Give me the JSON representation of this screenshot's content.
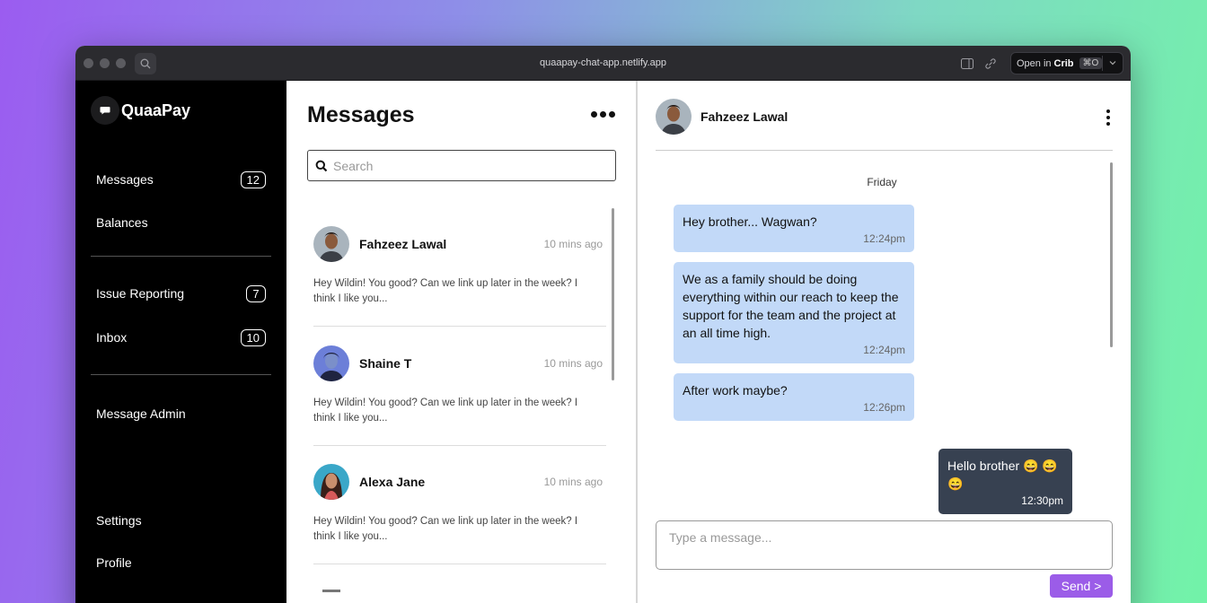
{
  "browser": {
    "url": "quaapay-chat-app.netlify.app",
    "open_in_prefix": "Open in",
    "open_in_app": "Crib",
    "open_shortcut": "⌘O"
  },
  "sidebar": {
    "brand": "QuaaPay",
    "items": [
      {
        "label": "Messages",
        "badge": "12"
      },
      {
        "label": "Balances",
        "badge": ""
      },
      {
        "label": "Issue Reporting",
        "badge": "7"
      },
      {
        "label": "Inbox",
        "badge": "10"
      },
      {
        "label": "Message Admin",
        "badge": ""
      },
      {
        "label": "Settings",
        "badge": ""
      },
      {
        "label": "Profile",
        "badge": ""
      }
    ]
  },
  "list": {
    "title": "Messages",
    "search_placeholder": "Search",
    "conversations": [
      {
        "name": "Fahzeez Lawal",
        "time": "10 mins ago",
        "preview": "Hey Wildin! You good? Can we link up later in the week? I think I like you..."
      },
      {
        "name": "Shaine T",
        "time": "10 mins ago",
        "preview": "Hey Wildin! You good? Can we link up later in the week? I think I like you..."
      },
      {
        "name": "Alexa Jane",
        "time": "10 mins ago",
        "preview": "Hey Wildin! You good? Can we link up later in the week? I think I like you..."
      }
    ]
  },
  "chat": {
    "contact": "Fahzeez Lawal",
    "day": "Friday",
    "messages": [
      {
        "dir": "in",
        "text": "Hey brother... Wagwan?",
        "time": "12:24pm"
      },
      {
        "dir": "in",
        "text": "We as a family should be doing everything within our reach to keep the support for the team and the project at an all time high.",
        "time": "12:24pm"
      },
      {
        "dir": "in",
        "text": "After work maybe?",
        "time": "12:26pm"
      },
      {
        "dir": "out",
        "text": "Hello brother 😄 😄 😄",
        "time": "12:30pm"
      }
    ],
    "compose_placeholder": "Type a message...",
    "send_label": "Send >"
  },
  "colors": {
    "incoming_bubble": "#c2d9f8",
    "outgoing_bubble": "#374151",
    "send_button": "#9b5ce8",
    "sidebar_bg": "#000000"
  }
}
